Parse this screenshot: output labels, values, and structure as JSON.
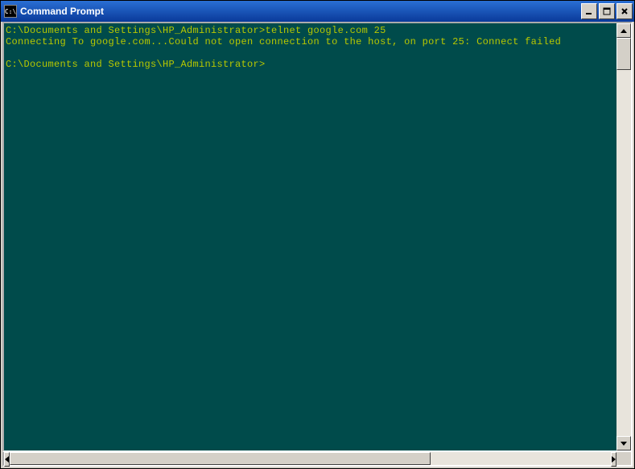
{
  "window": {
    "title": "Command Prompt",
    "icon_label": "C:\\"
  },
  "console": {
    "lines": [
      "C:\\Documents and Settings\\HP_Administrator>telnet google.com 25",
      "Connecting To google.com...Could not open connection to the host, on port 25: Connect failed",
      "",
      "C:\\Documents and Settings\\HP_Administrator>"
    ]
  },
  "colors": {
    "console_bg": "#004b4b",
    "console_fg": "#b8c800",
    "titlebar_start": "#2a6fd4",
    "titlebar_end": "#0a3a9a"
  }
}
